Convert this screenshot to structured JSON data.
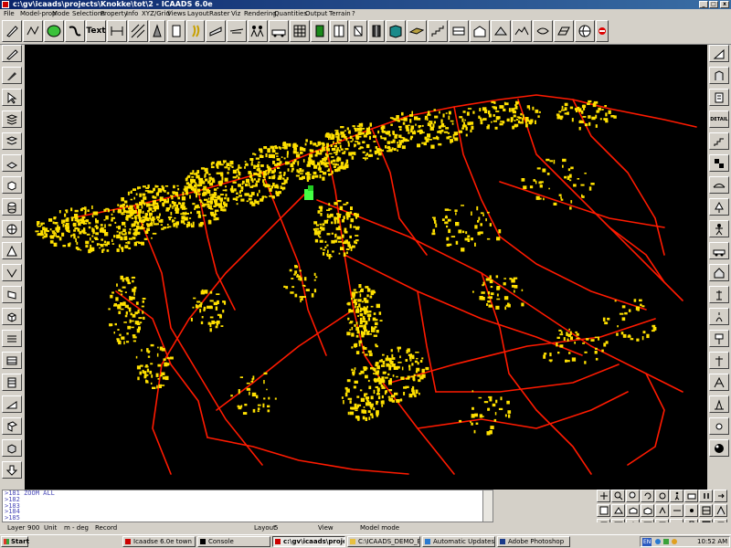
{
  "window": {
    "title": "c:\\gv\\icaads\\projects\\Knokke\\tot\\2 - ICAADS 6.0e"
  },
  "menu": [
    "File",
    "Model-prop",
    "Mode",
    "Selections",
    "Property",
    "Info",
    "XYZ/Grid",
    "Views",
    "Layout",
    "Raster",
    "Viz",
    "Rendering",
    "Quantities",
    "Output",
    "Terrain",
    "?"
  ],
  "toolbar": {
    "text_label": "Text"
  },
  "right_toolbar": {
    "detail_label": "DETAIL",
    "stair_label": "STAIR"
  },
  "console": {
    "lines": [
      ">181 ZOOM ALL",
      ">182",
      ">183",
      ">184",
      ">185"
    ]
  },
  "status": {
    "layer_label": "Layer",
    "layer_value": "900",
    "unit_label": "Unit",
    "unit_value": "m - deg",
    "record_label": "Record",
    "layout_label": "Layout",
    "layout_value": "5",
    "view_label": "View",
    "mode_label": "Model mode"
  },
  "taskbar": {
    "start": "Start",
    "tasks": [
      "Icaadse 6.0e town",
      "Console",
      "c:\\gv\\icaads\\project...",
      "C:\\ICAADS_DEMO_E\\bp...",
      "Automatic Updates",
      "Adobe Photoshop"
    ],
    "clock": "10:52 AM",
    "lang": "EN"
  },
  "colors": {
    "canvas": "#000000",
    "roads": "#ff1a00",
    "buildings": "#ffe000",
    "highlight": "#44ff44"
  }
}
